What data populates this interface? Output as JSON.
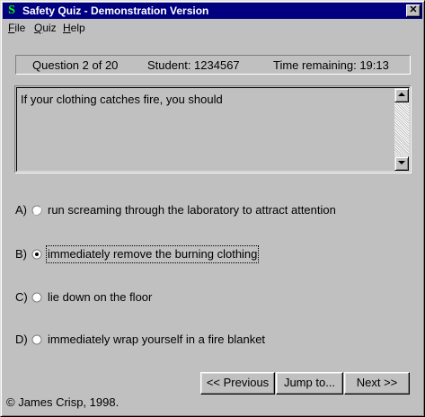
{
  "window": {
    "title": "Safety Quiz - Demonstration Version",
    "app_icon_glyph": "S",
    "close_glyph": "✕"
  },
  "menu": [
    {
      "label": "File",
      "accel": "F",
      "rest": "ile"
    },
    {
      "label": "Quiz",
      "accel": "Q",
      "rest": "uiz"
    },
    {
      "label": "Help",
      "accel": "H",
      "rest": "elp"
    }
  ],
  "status": {
    "question": "Question 2 of 20",
    "student": "Student:  1234567",
    "time": "Time remaining:  19:13"
  },
  "question": {
    "text": "If your clothing catches fire, you should"
  },
  "answers": [
    {
      "letter": "A)",
      "text": "run screaming through the laboratory to attract attention",
      "selected": false
    },
    {
      "letter": "B)",
      "text": "immediately remove the burning clothing",
      "selected": true
    },
    {
      "letter": "C)",
      "text": "lie down on the floor",
      "selected": false
    },
    {
      "letter": "D)",
      "text": "immediately wrap yourself in a fire blanket",
      "selected": false
    }
  ],
  "buttons": {
    "previous": "<< Previous",
    "jump": "Jump to...",
    "next": "Next >>"
  },
  "footer": {
    "copyright": "© James Crisp, 1998."
  },
  "icons": {
    "app": "app-s-icon",
    "close": "close-icon",
    "scroll_up": "scroll-up-arrow-icon",
    "scroll_down": "scroll-down-arrow-icon",
    "radio": "radio-button-icon"
  },
  "colors": {
    "titlebar": "#000080",
    "face": "#c0c0c0",
    "app_icon": "#00ff00"
  }
}
